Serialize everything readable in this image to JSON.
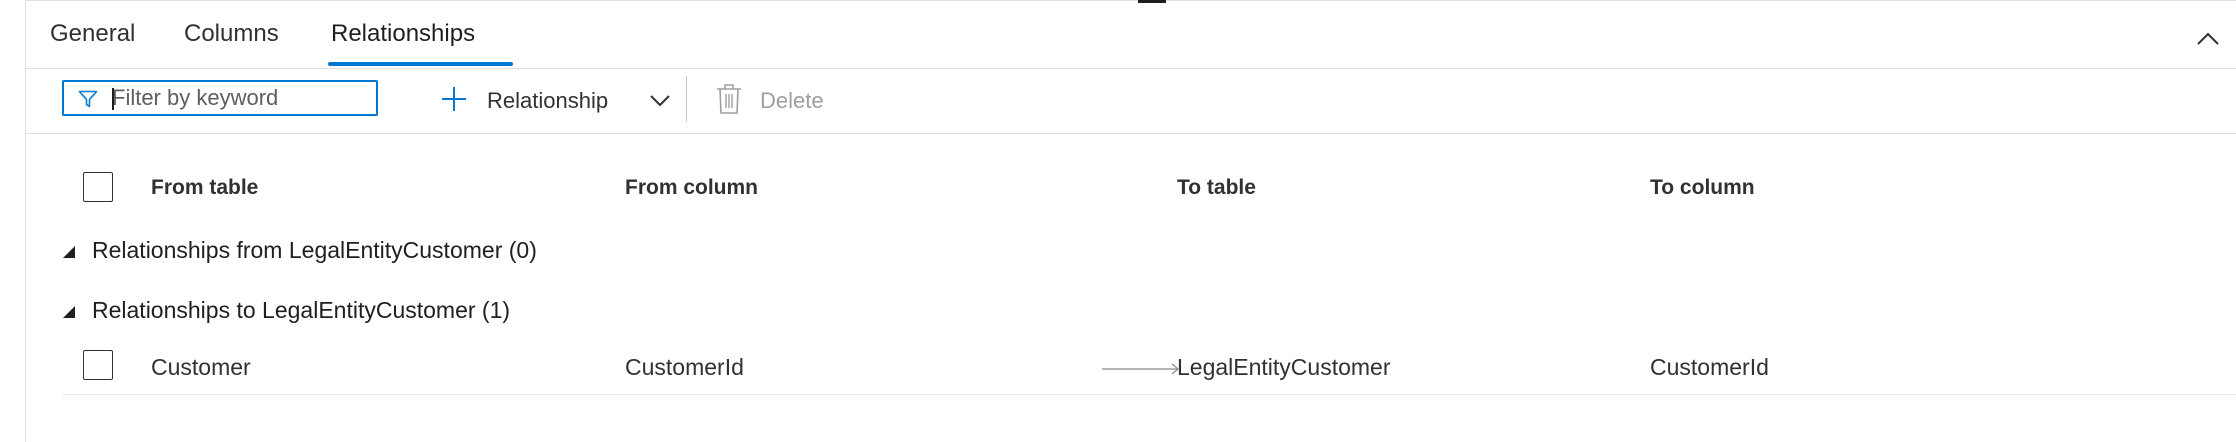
{
  "tabs": [
    {
      "label": "General"
    },
    {
      "label": "Columns"
    },
    {
      "label": "Relationships",
      "active": true
    }
  ],
  "toolbar": {
    "filter_placeholder": "Filter by keyword",
    "filter_value": "",
    "add_relationship_label": "Relationship",
    "delete_label": "Delete"
  },
  "grid": {
    "columns": [
      "From table",
      "From column",
      "To table",
      "To column"
    ],
    "groups": [
      {
        "label": "Relationships from LegalEntityCustomer (0)",
        "rows": []
      },
      {
        "label": "Relationships to LegalEntityCustomer (1)",
        "rows": [
          {
            "from_table": "Customer",
            "from_column": "CustomerId",
            "to_table": "LegalEntityCustomer",
            "to_column": "CustomerId"
          }
        ]
      }
    ]
  },
  "colors": {
    "accent": "#0078d4",
    "text": "#323130",
    "disabled": "#a19f9d",
    "border": "#e1dfdd"
  },
  "icons": [
    "filter-icon",
    "plus-icon",
    "chevron-down-icon",
    "trash-icon",
    "chevron-up-icon",
    "arrow-right-icon",
    "triangle-expanded-icon"
  ]
}
